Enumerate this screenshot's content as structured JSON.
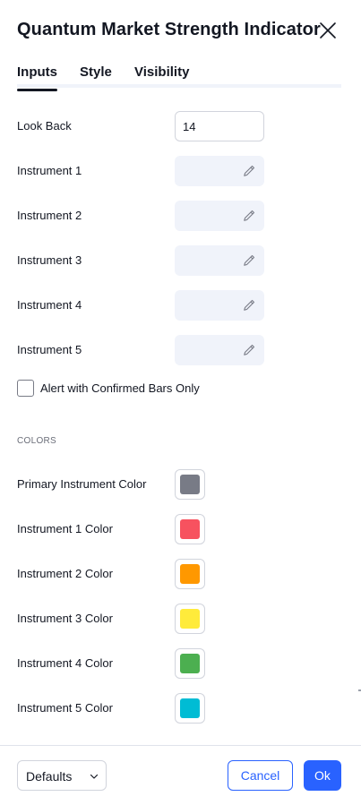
{
  "dialog": {
    "title": "Quantum Market Strength Indicator",
    "close_icon": "close-icon"
  },
  "tabs": [
    {
      "label": "Inputs",
      "active": true
    },
    {
      "label": "Style",
      "active": false
    },
    {
      "label": "Visibility",
      "active": false
    }
  ],
  "inputs": {
    "look_back": {
      "label": "Look Back",
      "value": "14"
    },
    "instruments": [
      {
        "label": "Instrument 1",
        "value": "",
        "icon": "pencil-icon"
      },
      {
        "label": "Instrument 2",
        "value": "",
        "icon": "pencil-icon"
      },
      {
        "label": "Instrument 3",
        "value": "",
        "icon": "pencil-icon"
      },
      {
        "label": "Instrument 4",
        "value": "",
        "icon": "pencil-icon"
      },
      {
        "label": "Instrument 5",
        "value": "",
        "icon": "pencil-icon"
      }
    ],
    "alert_checkbox": {
      "label": "Alert with Confirmed Bars Only",
      "checked": false
    }
  },
  "colors_section": {
    "heading": "COLORS",
    "items": [
      {
        "label": "Primary Instrument Color",
        "color": "#787b86"
      },
      {
        "label": "Instrument 1 Color",
        "color": "#f7525f"
      },
      {
        "label": "Instrument 2 Color",
        "color": "#ff9800"
      },
      {
        "label": "Instrument 3 Color",
        "color": "#ffeb3b"
      },
      {
        "label": "Instrument 4 Color",
        "color": "#4caf50"
      },
      {
        "label": "Instrument 5 Color",
        "color": "#00bcd4"
      }
    ]
  },
  "footer": {
    "defaults_label": "Defaults",
    "cancel_label": "Cancel",
    "ok_label": "Ok"
  },
  "theme": {
    "accent": "#2962ff",
    "text": "#131722"
  }
}
